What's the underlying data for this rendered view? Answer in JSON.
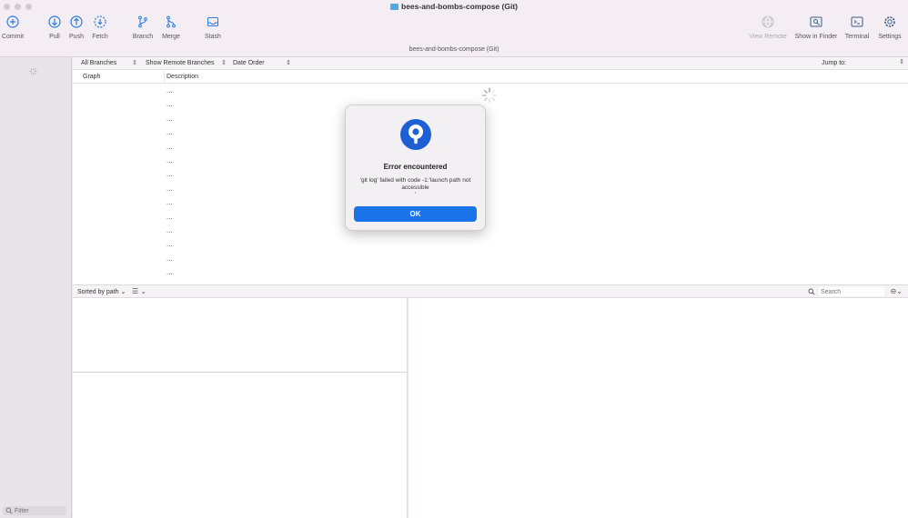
{
  "window": {
    "title": "bees-and-bombs-compose (Git)",
    "subtitle": "bees-and-bombs-compose (Git)"
  },
  "toolbar": {
    "commit": "Commit",
    "pull": "Pull",
    "push": "Push",
    "fetch": "Fetch",
    "branch": "Branch",
    "merge": "Merge",
    "stash": "Stash",
    "view_remote": "View Remote",
    "show_in_finder": "Show in Finder",
    "terminal": "Terminal",
    "settings": "Settings"
  },
  "filters": {
    "branches": "All Branches",
    "remote": "Show Remote Branches",
    "order": "Date Order",
    "jump_to": "Jump to:"
  },
  "columns": {
    "graph": "Graph",
    "description": "Description"
  },
  "rows": [
    "...",
    "...",
    "...",
    "...",
    "...",
    "...",
    "...",
    "...",
    "...",
    "...",
    "...",
    "...",
    "...",
    "..."
  ],
  "bottom": {
    "sort": "Sorted by path",
    "search_placeholder": "Search"
  },
  "sidebar": {
    "filter_placeholder": "Filter"
  },
  "dialog": {
    "title": "Error encountered",
    "message": "'git log' failed with code -1:'launch path not accessible",
    "message_tail": "'",
    "ok": "OK"
  },
  "colors": {
    "accent": "#1a73e8",
    "logo": "#1f5fd4"
  }
}
